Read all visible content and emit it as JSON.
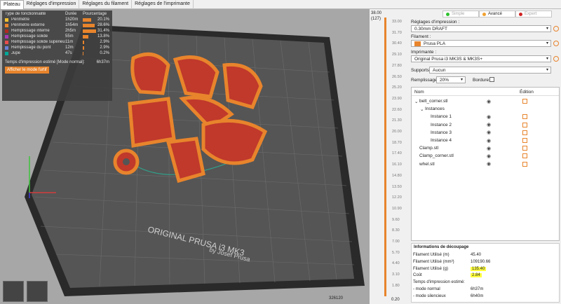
{
  "tabs": [
    "Plateau",
    "Réglages d'impression",
    "Réglages du filament",
    "Réglages de l'imprimante"
  ],
  "legend": {
    "headers": [
      "Type de fonctionnalité",
      "Durée",
      "Pourcentage"
    ],
    "rows": [
      {
        "label": "Périmètre",
        "time": "1h20m",
        "pct": "20.1%",
        "color": "#f1c232",
        "fill": 0.201
      },
      {
        "label": "Périmètre externe",
        "time": "1h54m",
        "pct": "28.6%",
        "color": "#e8842c",
        "fill": 0.286
      },
      {
        "label": "Remplissage interne",
        "time": "2h5m",
        "pct": "31.4%",
        "color": "#b02a20",
        "fill": 0.314
      },
      {
        "label": "Remplissage solide",
        "time": "55m",
        "pct": "13.8%",
        "color": "#a83ab5",
        "fill": 0.138
      },
      {
        "label": "Remplissage solide supérieur",
        "time": "11m",
        "pct": "2.9%",
        "color": "#e84c4c",
        "fill": 0.029
      },
      {
        "label": "Remplissage du pont",
        "time": "12m",
        "pct": "2.9%",
        "color": "#6b7fd6",
        "fill": 0.029
      },
      {
        "label": "Jupe",
        "time": "47s",
        "pct": "0.2%",
        "color": "#00a89a",
        "fill": 0.002
      }
    ],
    "time_label": "Temps d'impression estimé [Mode normal]:",
    "time_value": "6h37m",
    "stealth_button": "Afficher le mode furtif"
  },
  "bed": {
    "brand": "ORIGINAL PRUSA i3 MK3",
    "by": "by Josef Prusa"
  },
  "slider": {
    "top_value": "38.00",
    "top_layer": "(127)",
    "ticks": [
      "33.00",
      "31.70",
      "30.40",
      "29.10",
      "27.80",
      "26.50",
      "25.20",
      "23.90",
      "22.60",
      "21.30",
      "20.00",
      "18.70",
      "17.40",
      "16.10",
      "14.80",
      "13.50",
      "12.20",
      "10.90",
      "9.60",
      "8.30",
      "7.00",
      "5.70",
      "4.40",
      "3.10",
      "1.80"
    ],
    "bottom_value": "0.20",
    "bottom_left": "326120"
  },
  "modes": [
    {
      "label": "Simple",
      "color": "#2ec12e"
    },
    {
      "label": "Avancé",
      "color": "#f0a030"
    },
    {
      "label": "Expert",
      "color": "#d02020"
    }
  ],
  "print_settings": {
    "label": "Réglages d'impression :",
    "value": "0.30mm DRAFT"
  },
  "filament": {
    "label": "Filament :",
    "value": "Prusa PLA",
    "color": "#e8842c"
  },
  "printer": {
    "label": "Imprimante :",
    "value": "Original Prusa i3 MK3S & MK3S+"
  },
  "supports": {
    "label": "Supports:",
    "value": "Aucun"
  },
  "infill": {
    "label": "Remplissage:",
    "value": "20%",
    "brim_label": "Bordure:"
  },
  "tree": {
    "col_name": "Nom",
    "col_edit": "Édition",
    "items": [
      {
        "label": "belt_corner.stl",
        "indent": 0,
        "caret": "⌄"
      },
      {
        "label": "Instances",
        "indent": 1,
        "caret": "⌄"
      },
      {
        "label": "Instance 1",
        "indent": 2,
        "caret": ""
      },
      {
        "label": "Instance 2",
        "indent": 2,
        "caret": ""
      },
      {
        "label": "Instance 3",
        "indent": 2,
        "caret": ""
      },
      {
        "label": "Instance 4",
        "indent": 2,
        "caret": ""
      },
      {
        "label": "Clamp.stl",
        "indent": 0,
        "caret": ""
      },
      {
        "label": "Clamp_corner.stl",
        "indent": 0,
        "caret": ""
      },
      {
        "label": "whel.stl",
        "indent": 0,
        "caret": ""
      }
    ]
  },
  "slicing": {
    "title": "Informations de découpage",
    "rows": [
      {
        "k": "Filament Utilisé (m)",
        "v": "45.40"
      },
      {
        "k": "Filament Utilisé (mm³)",
        "v": "109190.66"
      },
      {
        "k": "Filament Utilisé (g)",
        "v": "135.40"
      },
      {
        "k": "Coût",
        "v": "2.84"
      },
      {
        "k": "Temps d'impression estimé:",
        "v": ""
      },
      {
        "k": "- mode normal",
        "v": "6h37m"
      },
      {
        "k": "- mode silencieux",
        "v": "6h40m"
      }
    ]
  }
}
